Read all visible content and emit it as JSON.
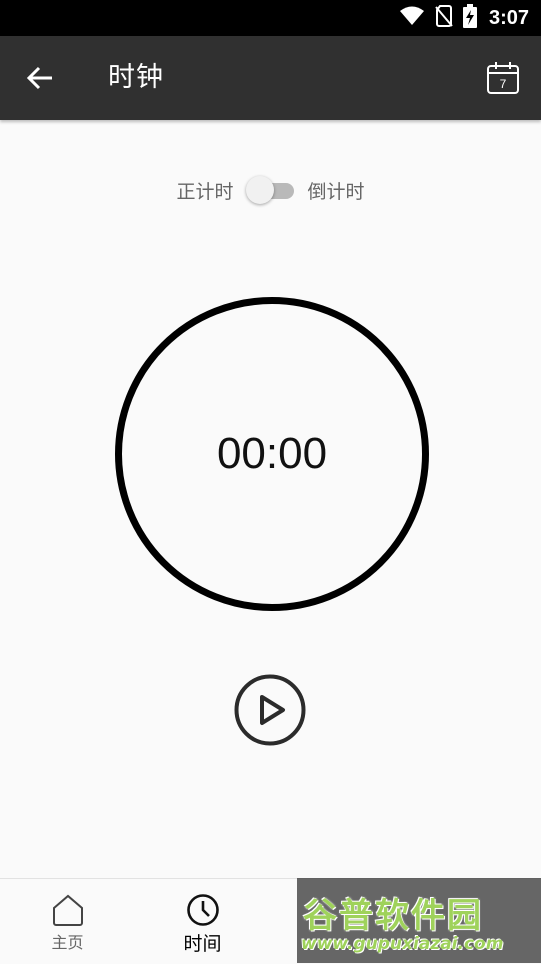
{
  "status_bar": {
    "time": "3:07",
    "icons": [
      "wifi-icon",
      "no-sim-icon",
      "battery-charging-icon"
    ]
  },
  "app_bar": {
    "title": "时钟",
    "back_icon": "arrow-left-icon",
    "action_icon": "calendar-icon",
    "calendar_day": "7"
  },
  "mode": {
    "left_label": "正计时",
    "right_label": "倒计时",
    "switch_on": false
  },
  "timer": {
    "value": "00:00"
  },
  "controls": {
    "play_icon": "play-icon"
  },
  "bottom_nav": {
    "items": [
      {
        "label": "主页",
        "icon": "home-icon",
        "active": false
      },
      {
        "label": "时间",
        "icon": "clock-icon",
        "active": true
      }
    ]
  },
  "watermark": {
    "text": "谷普软件园",
    "url": "www.gupuxiazai.com"
  },
  "colors": {
    "app_bar_bg": "#303030",
    "status_bar_bg": "#000000",
    "background": "#fafafa",
    "ring": "#000000"
  }
}
